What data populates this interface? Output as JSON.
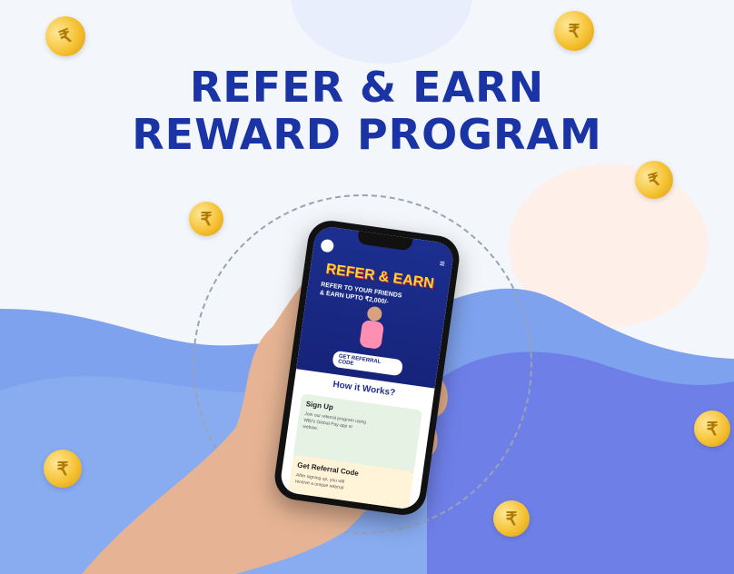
{
  "headline": {
    "line1": "REFER & EARN",
    "line2": "REWARD PROGRAM"
  },
  "coin_symbol": "₹",
  "phone": {
    "hero_title": "REFER & EARN",
    "hero_sub_1": "REFER TO YOUR FRIENDS",
    "hero_sub_2": "& EARN UPTO ₹2,000/-",
    "cta": "GET REFERRAL CODE",
    "how": "How it Works?",
    "steps": [
      {
        "title": "Sign Up",
        "desc": "Join our referral program using WBI's Global Pay app or websie."
      },
      {
        "title": "Get Referral Code",
        "desc": "After signing up, you will receive a unique referral"
      }
    ]
  }
}
